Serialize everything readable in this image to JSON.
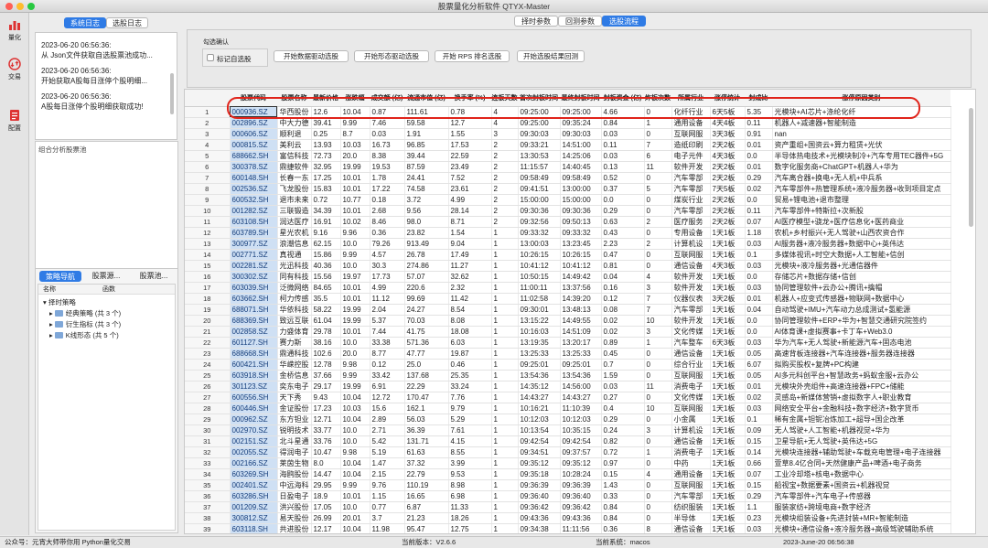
{
  "window": {
    "title": "股票量化分析软件 QTYX-Master"
  },
  "nav": {
    "items": [
      {
        "label": "量化",
        "icon": "bar-chart-icon"
      },
      {
        "label": "交易",
        "icon": "exchange-icon"
      },
      {
        "label": "配置",
        "icon": "config-icon"
      }
    ]
  },
  "log": {
    "tabs": [
      "系统日志",
      "选股日志"
    ],
    "entries": [
      {
        "time": "2023-06-20 06:56:36:",
        "text": "从 Json文件获取自选股票池成功..."
      },
      {
        "time": "2023-06-20 06:56:36:",
        "text": "开始获取A股每日涨停个股明细..."
      },
      {
        "time": "2023-06-20 06:56:36:",
        "text": "A股每日涨停个股明细获取成功!"
      }
    ]
  },
  "pool": {
    "title": "组合分析股票池"
  },
  "strategy": {
    "tabs": [
      "策略导航",
      "股票源...",
      "股票池..."
    ],
    "headers": [
      "名称",
      "函数"
    ],
    "root": "择时策略",
    "children": [
      "经典策略 (共 3 个)",
      "衍生指标 (共 3 个)",
      "K线形态 (共 5 个)"
    ]
  },
  "top_tabs": [
    "择时参数",
    "回测参数",
    "选股流程"
  ],
  "toolbar": {
    "group_label": "勾选确认",
    "checkbox_label": "标记自选股",
    "buttons": [
      "开始数据驱动选股",
      "开始形态驱动选股",
      "开始 RPS 排名选股",
      "开始选股结果回测"
    ]
  },
  "table": {
    "headers": [
      "股票代码",
      "股票名称",
      "最新价格",
      "涨跌幅",
      "成交额 (亿)",
      "流通市值 (亿)",
      "换手率 (%)",
      "连板天数",
      "首次封板时间",
      "最终封板时间",
      "封板资金 (亿)",
      "炸板次数",
      "所属行业",
      "涨停统计",
      "封成比",
      "涨停原因类别"
    ],
    "rows": [
      [
        "000936.SZ",
        "华西股份",
        "12.6",
        "10.04",
        "0.87",
        "111.61",
        "0.78",
        "4",
        "09:25:00",
        "09:25:00",
        "4.66",
        "0",
        "化纤行业",
        "6天5板",
        "5.35",
        "光模块+AI芯片+涤纶化纤"
      ],
      [
        "002896.SZ",
        "中大力德",
        "39.41",
        "9.99",
        "7.46",
        "59.58",
        "12.7",
        "4",
        "09:25:00",
        "09:35:24",
        "0.84",
        "1",
        "通用设备",
        "4天4板",
        "0.11",
        "机器人+减速器+智能制造"
      ],
      [
        "000606.SZ",
        "顺利退",
        "0.25",
        "8.7",
        "0.03",
        "1.91",
        "1.55",
        "3",
        "09:30:03",
        "09:30:03",
        "0.03",
        "0",
        "互联网服",
        "3天3板",
        "0.91",
        "nan"
      ],
      [
        "000815.SZ",
        "美利云",
        "13.93",
        "10.03",
        "16.73",
        "96.85",
        "17.53",
        "2",
        "09:33:21",
        "14:51:00",
        "0.11",
        "7",
        "造纸印刷",
        "2天2板",
        "0.01",
        "资产重组+国资云+算力租赁+光伏"
      ],
      [
        "688662.SH",
        "富信科技",
        "72.73",
        "20.0",
        "8.38",
        "39.44",
        "22.59",
        "2",
        "13:30:53",
        "14:25:06",
        "0.03",
        "6",
        "电子元件",
        "4天3板",
        "0.0",
        "半导体热电技术+光模块制冷+汽车专用TEC器件+5G"
      ],
      [
        "300378.SZ",
        "鼎捷软件",
        "32.95",
        "19.99",
        "19.53",
        "87.59",
        "23.49",
        "2",
        "11:15:57",
        "14:40:45",
        "0.13",
        "11",
        "软件开发",
        "2天2板",
        "0.01",
        "数字化服务商+ChatGPT+机器人+华为"
      ],
      [
        "600148.SH",
        "长春一东",
        "17.25",
        "10.01",
        "1.78",
        "24.41",
        "7.52",
        "2",
        "09:58:49",
        "09:58:49",
        "0.52",
        "0",
        "汽车零部",
        "2天2板",
        "0.29",
        "汽车离合器+换电+无人机+中兵系"
      ],
      [
        "002536.SZ",
        "飞龙股份",
        "15.83",
        "10.01",
        "17.22",
        "74.58",
        "23.61",
        "2",
        "09:41:51",
        "13:00:00",
        "0.37",
        "5",
        "汽车零部",
        "7天5板",
        "0.02",
        "汽车零部件+热管理系统+液冷服务器+收到项目定点"
      ],
      [
        "600532.SH",
        "退市未来",
        "0.72",
        "10.77",
        "0.18",
        "3.72",
        "4.99",
        "2",
        "15:00:00",
        "15:00:00",
        "0.0",
        "0",
        "煤炭行业",
        "2天2板",
        "0.0",
        "贸易+锂电池+退市整理"
      ],
      [
        "001282.SZ",
        "三联锻造",
        "34.39",
        "10.01",
        "2.68",
        "9.56",
        "28.14",
        "2",
        "09:30:36",
        "09:30:36",
        "0.29",
        "0",
        "汽车零部",
        "2天2板",
        "0.11",
        "汽车零部件+特斯拉+次新股"
      ],
      [
        "603108.SH",
        "润达医疗",
        "16.91",
        "10.02",
        "8.46",
        "98.0",
        "8.71",
        "2",
        "09:32:56",
        "09:50:13",
        "0.63",
        "2",
        "医疗服务",
        "2天2板",
        "0.07",
        "AI医疗模型+骁龙+医疗信息化+医药商业"
      ],
      [
        "603789.SH",
        "星光农机",
        "9.16",
        "9.96",
        "0.36",
        "23.82",
        "1.54",
        "1",
        "09:33:32",
        "09:33:32",
        "0.43",
        "0",
        "专用设备",
        "1天1板",
        "1.18",
        "农机+乡村振兴+无人驾驶+山西农资合作"
      ],
      [
        "300977.SZ",
        "浪潮信息",
        "62.15",
        "10.0",
        "79.26",
        "913.49",
        "9.04",
        "1",
        "13:00:03",
        "13:23:45",
        "2.23",
        "2",
        "计算机设",
        "1天1板",
        "0.03",
        "AI服务器+液冷服务器+数据中心+英伟达"
      ],
      [
        "002771.SZ",
        "真视通",
        "15.86",
        "9.99",
        "4.57",
        "26.78",
        "17.49",
        "1",
        "10:26:15",
        "10:26:15",
        "0.47",
        "0",
        "互联网服",
        "1天1板",
        "0.1",
        "多媒体视讯+时空大数据+人工智能+信创"
      ],
      [
        "002281.SZ",
        "光迅科技",
        "40.36",
        "10.0",
        "30.3",
        "274.86",
        "11.27",
        "1",
        "10:41:12",
        "10:41:12",
        "0.81",
        "0",
        "通信设备",
        "4天3板",
        "0.03",
        "光模块+液冷服务器+光通信器件"
      ],
      [
        "300302.SZ",
        "同有科技",
        "15.56",
        "19.97",
        "17.73",
        "57.07",
        "32.62",
        "1",
        "10:50:15",
        "14:49:42",
        "0.04",
        "4",
        "软件开发",
        "1天1板",
        "0.0",
        "存储芯片+数据存储+信创"
      ],
      [
        "603039.SH",
        "泛微网络",
        "84.65",
        "10.01",
        "4.99",
        "220.6",
        "2.32",
        "1",
        "11:00:11",
        "13:37:56",
        "0.16",
        "3",
        "软件开发",
        "1天1板",
        "0.03",
        "协同管理软件+云办公+腾讯+擒帽"
      ],
      [
        "603662.SH",
        "柯力传感",
        "35.5",
        "10.01",
        "11.12",
        "99.69",
        "11.42",
        "1",
        "11:02:58",
        "14:39:20",
        "0.12",
        "7",
        "仪器仪表",
        "3天2板",
        "0.01",
        "机器人+应变式传感器+物联网+数据中心"
      ],
      [
        "688071.SH",
        "华依科技",
        "58.22",
        "19.99",
        "2.04",
        "24.27",
        "8.54",
        "1",
        "09:30:01",
        "13:48:13",
        "0.08",
        "7",
        "汽车零部",
        "1天1板",
        "0.04",
        "自动驾驶+IMU+汽车动力总成测试+氢能源"
      ],
      [
        "688369.SH",
        "致远互联",
        "61.04",
        "19.99",
        "5.37",
        "70.03",
        "8.08",
        "1",
        "13:15:22",
        "14:49:55",
        "0.02",
        "10",
        "软件开发",
        "1天1板",
        "0.0",
        "协同管理软件+ERP+华为+智慧交通研究院签约"
      ],
      [
        "002858.SZ",
        "力盛体育",
        "29.78",
        "10.01",
        "7.44",
        "41.75",
        "18.08",
        "1",
        "10:16:03",
        "14:51:09",
        "0.02",
        "3",
        "文化传媒",
        "1天1板",
        "0.0",
        "AI体育课+虚拟赛事+卡丁车+Web3.0"
      ],
      [
        "601127.SH",
        "赛力斯",
        "38.16",
        "10.0",
        "33.38",
        "571.36",
        "6.03",
        "1",
        "13:19:35",
        "13:20:17",
        "0.89",
        "1",
        "汽车整车",
        "6天3板",
        "0.03",
        "华为汽车+无人驾驶+新能源汽车+固态电池"
      ],
      [
        "688668.SH",
        "鼎通科技",
        "102.6",
        "20.0",
        "8.77",
        "47.77",
        "19.87",
        "1",
        "13:25:33",
        "13:25:33",
        "0.45",
        "0",
        "通信设备",
        "1天1板",
        "0.05",
        "高速背板连接器+汽车连接器+服务器连接器"
      ],
      [
        "600421.SH",
        "华嵘控股",
        "12.78",
        "9.98",
        "0.12",
        "25.0",
        "0.46",
        "1",
        "09:25:01",
        "09:25:01",
        "0.7",
        "0",
        "综合行业",
        "1天1板",
        "6.07",
        "拟购买股权+复牌+PC构建"
      ],
      [
        "603918.SH",
        "金桥信息",
        "37.66",
        "9.99",
        "33.42",
        "137.68",
        "25.35",
        "1",
        "13:54:36",
        "13:54:36",
        "1.59",
        "0",
        "互联网服",
        "1天1板",
        "0.05",
        "AI多元科创平台+智慧政务+蚂蚁金服+云办公"
      ],
      [
        "301123.SZ",
        "奕东电子",
        "29.17",
        "19.99",
        "6.91",
        "22.29",
        "33.24",
        "1",
        "14:35:12",
        "14:56:00",
        "0.03",
        "11",
        "消费电子",
        "1天1板",
        "0.01",
        "光模块外壳组件+高速连接器+FPC+储能"
      ],
      [
        "600556.SH",
        "天下秀",
        "9.43",
        "10.04",
        "12.72",
        "170.47",
        "7.76",
        "1",
        "14:43:27",
        "14:43:27",
        "0.27",
        "0",
        "文化传媒",
        "1天1板",
        "0.02",
        "灵感岛+新媒体营销+虚拟数字人+职业教育"
      ],
      [
        "600446.SH",
        "金证股份",
        "17.23",
        "10.03",
        "15.6",
        "162.1",
        "9.79",
        "1",
        "10:16:21",
        "11:10:39",
        "0.4",
        "10",
        "互联网服",
        "1天1板",
        "0.03",
        "网络安全平台+金融科技+数字经济+数字货币"
      ],
      [
        "000962.SZ",
        "东方钽业",
        "12.71",
        "10.04",
        "2.89",
        "56.03",
        "5.29",
        "1",
        "10:12:03",
        "10:12:03",
        "0.29",
        "0",
        "小金属",
        "1天1板",
        "0.1",
        "稀有金属+钽铌冶炼加工+超导+国企改革"
      ],
      [
        "002970.SZ",
        "锐明技术",
        "33.77",
        "10.0",
        "2.71",
        "36.39",
        "7.61",
        "1",
        "10:13:54",
        "10:35:15",
        "0.24",
        "3",
        "计算机设",
        "1天1板",
        "0.09",
        "无人驾驶+人工智能+机器视觉+华为"
      ],
      [
        "002151.SZ",
        "北斗星通",
        "33.76",
        "10.0",
        "5.42",
        "131.71",
        "4.15",
        "1",
        "09:42:54",
        "09:42:54",
        "0.82",
        "0",
        "通信设备",
        "1天1板",
        "0.15",
        "卫星导航+无人驾驶+英伟达+5G"
      ],
      [
        "002055.SZ",
        "得润电子",
        "10.47",
        "9.98",
        "5.19",
        "61.63",
        "8.55",
        "1",
        "09:34:51",
        "09:37:57",
        "0.72",
        "1",
        "消费电子",
        "1天1板",
        "0.14",
        "光模块连接器+辅助驾驶+车载充电管理+电子连接器"
      ],
      [
        "002166.SZ",
        "莱茵生物",
        "8.0",
        "10.04",
        "1.47",
        "37.32",
        "3.99",
        "1",
        "09:35:12",
        "09:35:12",
        "0.97",
        "0",
        "中药",
        "1天1板",
        "0.66",
        "萱草8.4亿合同+天然健康产品+啤酒+电子商务"
      ],
      [
        "603269.SH",
        "海鸥股份",
        "14.47",
        "10.04",
        "2.15",
        "22.79",
        "9.53",
        "1",
        "09:35:18",
        "10:28:24",
        "0.15",
        "4",
        "通用设备",
        "1天1板",
        "0.07",
        "工业冷却塔+核电+数据中心"
      ],
      [
        "002401.SZ",
        "中远海科",
        "29.95",
        "9.99",
        "9.76",
        "110.19",
        "8.98",
        "1",
        "09:36:39",
        "09:36:39",
        "1.43",
        "0",
        "互联网服",
        "1天1板",
        "0.15",
        "船视宝+数据要素+国资云+机器视觉"
      ],
      [
        "603286.SH",
        "日盈电子",
        "18.9",
        "10.01",
        "1.15",
        "16.65",
        "6.98",
        "1",
        "09:36:40",
        "09:36:40",
        "0.33",
        "0",
        "汽车零部",
        "1天1板",
        "0.29",
        "汽车零部件+汽车电子+传感器"
      ],
      [
        "001209.SZ",
        "洪兴股份",
        "17.05",
        "10.0",
        "0.77",
        "6.87",
        "11.33",
        "1",
        "09:36:42",
        "09:36:42",
        "0.84",
        "0",
        "纺织服装",
        "1天1板",
        "1.1",
        "服装家纺+跨境电商+数字经济"
      ],
      [
        "300812.SZ",
        "易天股份",
        "26.99",
        "20.01",
        "3.7",
        "21.23",
        "18.26",
        "1",
        "09:43:36",
        "09:43:36",
        "0.84",
        "0",
        "半导体",
        "1天1板",
        "0.23",
        "光模块组装设备+先进封装+MR+智能制造"
      ],
      [
        "603118.SH",
        "共进股份",
        "12.17",
        "10.04",
        "11.98",
        "95.47",
        "12.75",
        "1",
        "09:34:38",
        "11:11:56",
        "0.36",
        "8",
        "通信设备",
        "1天1板",
        "0.03",
        "光模块+通信设备+液冷服务器+高级驾驶辅助系统"
      ]
    ]
  },
  "status": {
    "left": "公众号：元宵大师带你用 Python量化交易",
    "version": "当前版本：V2.6.6",
    "os": "当前系统：macos",
    "time": "2023-June-20 06:56:38"
  },
  "colors": {
    "accent": "#2f7be5",
    "highlight_oval": "#e0241b",
    "code_cell": "#cfe0f4"
  }
}
